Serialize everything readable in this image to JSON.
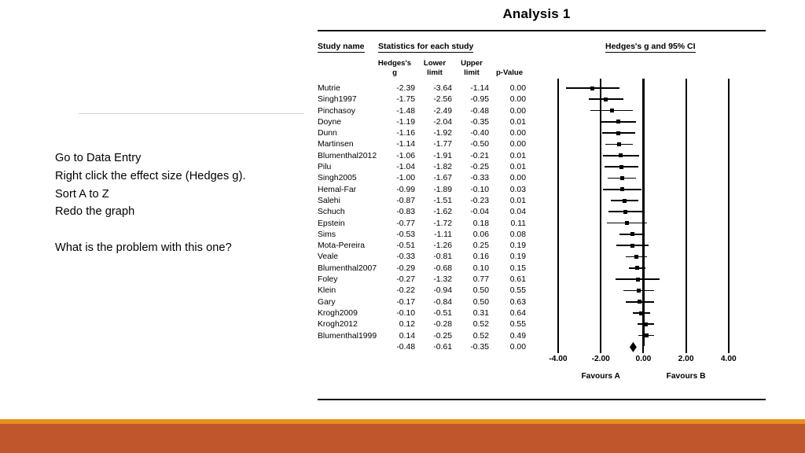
{
  "slide": {
    "instructions": [
      "Go to Data Entry",
      "Right click the effect size (Hedges g).",
      "Sort A to Z",
      "Redo the graph"
    ],
    "question": "What is the problem with this one?"
  },
  "report": {
    "title": "Analysis 1",
    "group_headers": {
      "study_name": "Study name",
      "statistics": "Statistics for each study",
      "forest": "Hedges's g and 95% CI"
    },
    "column_headers": {
      "hedges_g": "Hedges's\ng",
      "lower_limit": "Lower\nlimit",
      "upper_limit": "Upper\nlimit",
      "p_value": "p-Value"
    },
    "axis": {
      "ticks": [
        "-4.00",
        "-2.00",
        "0.00",
        "2.00",
        "4.00"
      ],
      "favours_left": "Favours A",
      "favours_right": "Favours B"
    }
  },
  "chart_data": {
    "type": "scatter",
    "title": "Analysis 1",
    "xlabel": "Hedges's g and 95% CI",
    "ylabel": "Study name",
    "xlim": [
      -5,
      5
    ],
    "xticks": [
      -4,
      -2,
      0,
      2,
      4
    ],
    "xtick_labels": [
      "-4.00",
      "-2.00",
      "0.00",
      "2.00",
      "4.00"
    ],
    "grid": true,
    "legend": "none",
    "annotations": [
      "Favours A",
      "Favours B"
    ],
    "columns": [
      "Study name",
      "Hedges's g",
      "Lower limit",
      "Upper limit",
      "p-Value"
    ],
    "rows": [
      {
        "name": "Mutrie",
        "g": "-2.39",
        "lower": "-3.64",
        "upper": "-1.14",
        "p": "0.00",
        "gv": -2.39,
        "lv": -3.64,
        "uv": -1.14
      },
      {
        "name": "Singh1997",
        "g": "-1.75",
        "lower": "-2.56",
        "upper": "-0.95",
        "p": "0.00",
        "gv": -1.75,
        "lv": -2.56,
        "uv": -0.95
      },
      {
        "name": "Pinchasoy",
        "g": "-1.48",
        "lower": "-2.49",
        "upper": "-0.48",
        "p": "0.00",
        "gv": -1.48,
        "lv": -2.49,
        "uv": -0.48
      },
      {
        "name": "Doyne",
        "g": "-1.19",
        "lower": "-2.04",
        "upper": "-0.35",
        "p": "0.01",
        "gv": -1.19,
        "lv": -2.04,
        "uv": -0.35
      },
      {
        "name": "Dunn",
        "g": "-1.16",
        "lower": "-1.92",
        "upper": "-0.40",
        "p": "0.00",
        "gv": -1.16,
        "lv": -1.92,
        "uv": -0.4
      },
      {
        "name": "Martinsen",
        "g": "-1.14",
        "lower": "-1.77",
        "upper": "-0.50",
        "p": "0.00",
        "gv": -1.14,
        "lv": -1.77,
        "uv": -0.5
      },
      {
        "name": "Blumenthal2012",
        "g": "-1.06",
        "lower": "-1.91",
        "upper": "-0.21",
        "p": "0.01",
        "gv": -1.06,
        "lv": -1.91,
        "uv": -0.21
      },
      {
        "name": "Pilu",
        "g": "-1.04",
        "lower": "-1.82",
        "upper": "-0.25",
        "p": "0.01",
        "gv": -1.04,
        "lv": -1.82,
        "uv": -0.25
      },
      {
        "name": "Singh2005",
        "g": "-1.00",
        "lower": "-1.67",
        "upper": "-0.33",
        "p": "0.00",
        "gv": -1.0,
        "lv": -1.67,
        "uv": -0.33
      },
      {
        "name": "Hemal-Far",
        "g": "-0.99",
        "lower": "-1.89",
        "upper": "-0.10",
        "p": "0.03",
        "gv": -0.99,
        "lv": -1.89,
        "uv": -0.1
      },
      {
        "name": "Salehi",
        "g": "-0.87",
        "lower": "-1.51",
        "upper": "-0.23",
        "p": "0.01",
        "gv": -0.87,
        "lv": -1.51,
        "uv": -0.23
      },
      {
        "name": "Schuch",
        "g": "-0.83",
        "lower": "-1.62",
        "upper": "-0.04",
        "p": "0.04",
        "gv": -0.83,
        "lv": -1.62,
        "uv": -0.04
      },
      {
        "name": "Epstein",
        "g": "-0.77",
        "lower": "-1.72",
        "upper": "0.18",
        "p": "0.11",
        "gv": -0.77,
        "lv": -1.72,
        "uv": 0.18
      },
      {
        "name": "Sims",
        "g": "-0.53",
        "lower": "-1.11",
        "upper": "0.06",
        "p": "0.08",
        "gv": -0.53,
        "lv": -1.11,
        "uv": 0.06
      },
      {
        "name": "Mota-Pereira",
        "g": "-0.51",
        "lower": "-1.26",
        "upper": "0.25",
        "p": "0.19",
        "gv": -0.51,
        "lv": -1.26,
        "uv": 0.25
      },
      {
        "name": "Veale",
        "g": "-0.33",
        "lower": "-0.81",
        "upper": "0.16",
        "p": "0.19",
        "gv": -0.33,
        "lv": -0.81,
        "uv": 0.16
      },
      {
        "name": "Blumenthal2007",
        "g": "-0.29",
        "lower": "-0.68",
        "upper": "0.10",
        "p": "0.15",
        "gv": -0.29,
        "lv": -0.68,
        "uv": 0.1
      },
      {
        "name": "Foley",
        "g": "-0.27",
        "lower": "-1.32",
        "upper": "0.77",
        "p": "0.61",
        "gv": -0.27,
        "lv": -1.32,
        "uv": 0.77
      },
      {
        "name": "Klein",
        "g": "-0.22",
        "lower": "-0.94",
        "upper": "0.50",
        "p": "0.55",
        "gv": -0.22,
        "lv": -0.94,
        "uv": 0.5
      },
      {
        "name": "Gary",
        "g": "-0.17",
        "lower": "-0.84",
        "upper": "0.50",
        "p": "0.63",
        "gv": -0.17,
        "lv": -0.84,
        "uv": 0.5
      },
      {
        "name": "Krogh2009",
        "g": "-0.10",
        "lower": "-0.51",
        "upper": "0.31",
        "p": "0.64",
        "gv": -0.1,
        "lv": -0.51,
        "uv": 0.31
      },
      {
        "name": "Krogh2012",
        "g": "0.12",
        "lower": "-0.28",
        "upper": "0.52",
        "p": "0.55",
        "gv": 0.12,
        "lv": -0.28,
        "uv": 0.52
      },
      {
        "name": "Blumenthal1999",
        "g": "0.14",
        "lower": "-0.25",
        "upper": "0.52",
        "p": "0.49",
        "gv": 0.14,
        "lv": -0.25,
        "uv": 0.52
      },
      {
        "name": "",
        "g": "-0.48",
        "lower": "-0.61",
        "upper": "-0.35",
        "p": "0.00",
        "gv": -0.48,
        "lv": -0.61,
        "uv": -0.35,
        "summary": true
      }
    ]
  }
}
